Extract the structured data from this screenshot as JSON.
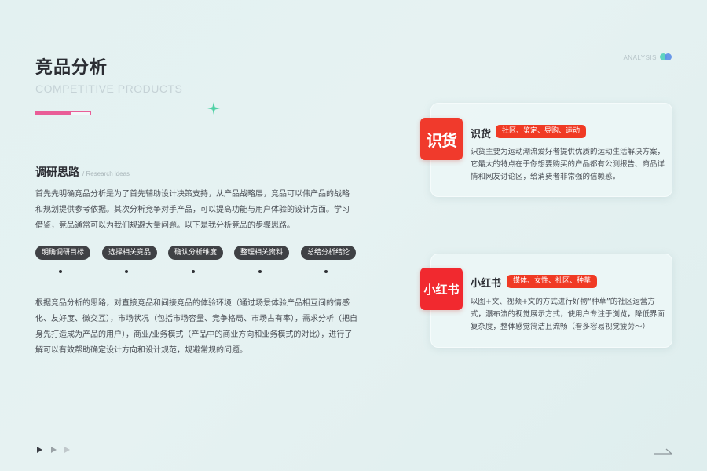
{
  "header": {
    "title": "竞品分析",
    "subtitle": "COMPETITIVE PRODUCTS",
    "progress_fraction": 0.64,
    "analysis_label": "ANALYSIS"
  },
  "research": {
    "title": "调研思路",
    "subtitle": "/ Research ideas",
    "paragraph1": "首先先明确竞品分析是为了首先辅助设计决策支持，从产品战略层，竞品可以伟产品的战略和规划提供参考依据。其次分析竞争对手产品，可以提高功能与用户体验的设计方面。学习借鉴，竞品通常可以为我们规避大量问题。以下是我分析竞品的步骤思路。",
    "steps": [
      "明确调研目标",
      "选择相关竞品",
      "确认分析维度",
      "整理相关资料",
      "总结分析结论"
    ],
    "paragraph2": "根据竞品分析的思路，对直接竞品和间接竞品的体验环境（通过场景体验产品相互间的情感化、友好度、微交互），市场状况（包括市场容量、竞争格局、市场占有率），需求分析（把自身先打造成为产品的用户），商业/业务模式（产品中的商业方向和业务模式的对比），进行了解可以有效帮助确定设计方向和设计规范，规避常规的问题。"
  },
  "cards": [
    {
      "logo_text": "识货",
      "name": "识货",
      "tag": "社区、鉴定、导购、运动",
      "desc": "识货主要为运动潮流爱好者提供优质的运动生活解决方案，它最大的特点在于你想要购买的产品都有公测报告、商品详情和网友讨论区，给消费者非常强的信赖感。"
    },
    {
      "logo_text": "小红书",
      "name": "小红书",
      "tag": "媒体、女性、社区、种草",
      "desc": "以图+文、视频+文的方式进行好物“种草”的社区运营方式，瀑布流的视觉展示方式，使用户专注于浏览，降低界面复杂度，整体感觉简洁且流畅（看多容易视觉疲劳～）"
    }
  ],
  "colors": {
    "accent_pink": "#e95d97",
    "brand_red": "#f03a2c",
    "pill_dark": "#3f4145"
  }
}
